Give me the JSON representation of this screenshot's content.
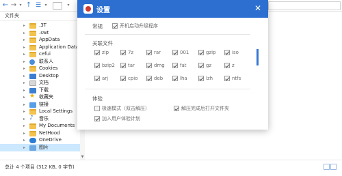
{
  "explorer": {
    "toolbar": {
      "back": "←",
      "forward": "→",
      "dropdown": "▾",
      "up": "↑",
      "view": "☰",
      "view_dropdown": "▾",
      "menu_dropdown": "▾"
    },
    "sidebar_header": "文件夹",
    "tree": [
      {
        "label": ".3T",
        "icon": "folder"
      },
      {
        "label": ".swt",
        "icon": "folder"
      },
      {
        "label": "AppData",
        "icon": "folder"
      },
      {
        "label": "Application Data",
        "icon": "folder"
      },
      {
        "label": "cefui",
        "icon": "folder"
      },
      {
        "label": "联系人",
        "icon": "user"
      },
      {
        "label": "Cookies",
        "icon": "folder"
      },
      {
        "label": "Desktop",
        "icon": "blue"
      },
      {
        "label": "文档",
        "icon": "docs"
      },
      {
        "label": "下载",
        "icon": "blue"
      },
      {
        "label": "收藏夹",
        "icon": "star"
      },
      {
        "label": "链接",
        "icon": "link"
      },
      {
        "label": "Local Settings",
        "icon": "folder"
      },
      {
        "label": "音乐",
        "icon": "music"
      },
      {
        "label": "My Documents",
        "icon": "folder"
      },
      {
        "label": "NetHood",
        "icon": "folder"
      },
      {
        "label": "OneDrive",
        "icon": "cloud"
      },
      {
        "label": "图片",
        "icon": "pics",
        "selected": true
      }
    ],
    "status": "总计 4 个项目 (312 KB, 0 字节)"
  },
  "settings": {
    "title": "设置",
    "close": "✕",
    "general_label": "常规",
    "auto_upgrade": {
      "label": "开机启动升级程序",
      "checked": true
    },
    "assoc_label": "关联文件",
    "formats": [
      {
        "label": "zip",
        "checked": true
      },
      {
        "label": "7z",
        "checked": true
      },
      {
        "label": "rar",
        "checked": true
      },
      {
        "label": "001",
        "checked": true
      },
      {
        "label": "gzip",
        "checked": true
      },
      {
        "label": "iso",
        "checked": true
      },
      {
        "label": "bzip2",
        "checked": true
      },
      {
        "label": "tar",
        "checked": true
      },
      {
        "label": "dmg",
        "checked": true
      },
      {
        "label": "fat",
        "checked": true
      },
      {
        "label": "gz",
        "checked": true
      },
      {
        "label": "z",
        "checked": true
      },
      {
        "label": "arj",
        "checked": true
      },
      {
        "label": "cpio",
        "checked": true
      },
      {
        "label": "deb",
        "checked": true
      },
      {
        "label": "lha",
        "checked": true
      },
      {
        "label": "lzh",
        "checked": true
      },
      {
        "label": "ntfs",
        "checked": true
      }
    ],
    "experience_label": "体验",
    "options": [
      {
        "label": "极速模式（双击解压）",
        "checked": false
      },
      {
        "label": "解压完成后打开文件夹",
        "checked": true
      },
      {
        "label": "加入用户体验计划",
        "checked": true
      }
    ]
  },
  "colors": {
    "title_bar": "#2c6fd0",
    "selection": "#cce8ff",
    "folder": "#f3c24f"
  }
}
